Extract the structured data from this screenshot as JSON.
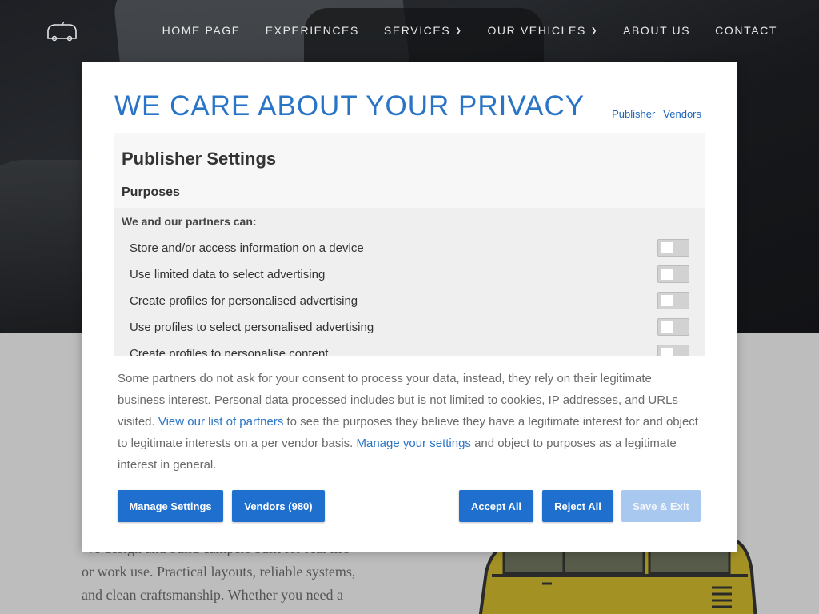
{
  "nav": {
    "items": [
      {
        "label": "HOME PAGE"
      },
      {
        "label": "EXPERIENCES"
      },
      {
        "label": "SERVICES",
        "dropdown": true
      },
      {
        "label": "OUR VEHICLES",
        "dropdown": true
      },
      {
        "label": "ABOUT US"
      },
      {
        "label": "CONTACT"
      }
    ]
  },
  "background_text": {
    "line1": "We design and build campers built for real life",
    "line2": "or work use. Practical layouts, reliable systems,",
    "line3": "and clean craftsmanship. Whether you need a"
  },
  "modal": {
    "title": "WE CARE ABOUT YOUR PRIVACY",
    "top_links": [
      "Publisher",
      "Vendors"
    ],
    "settings_title": "Publisher Settings",
    "purposes_title": "Purposes",
    "partners_label": "We and our partners can:",
    "purposes": [
      {
        "label": "Store and/or access information on a device",
        "enabled": false
      },
      {
        "label": "Use limited data to select advertising",
        "enabled": false
      },
      {
        "label": "Create profiles for personalised advertising",
        "enabled": false
      },
      {
        "label": "Use profiles to select personalised advertising",
        "enabled": false
      },
      {
        "label": "Create profiles to personalise content",
        "enabled": false
      }
    ],
    "info": {
      "part1": "Some partners do not ask for your consent to process your data, instead, they rely on their legitimate business interest. Personal data processed includes but is not limited to cookies, IP addresses, and URLs visited. ",
      "link1": "View our list of partners",
      "part2": " to see the purposes they believe they have a legitimate interest for and object to legitimate interests on a per vendor basis. ",
      "link2": "Manage your settings",
      "part3": " and object to purposes as a legitimate interest in general."
    },
    "buttons": {
      "manage": "Manage Settings",
      "vendors": "Vendors (980)",
      "accept": "Accept All",
      "reject": "Reject All",
      "save": "Save & Exit"
    }
  },
  "colors": {
    "accent": "#1f6fcf",
    "title": "#2a74c7",
    "disabled_button": "#a9c8ef"
  }
}
